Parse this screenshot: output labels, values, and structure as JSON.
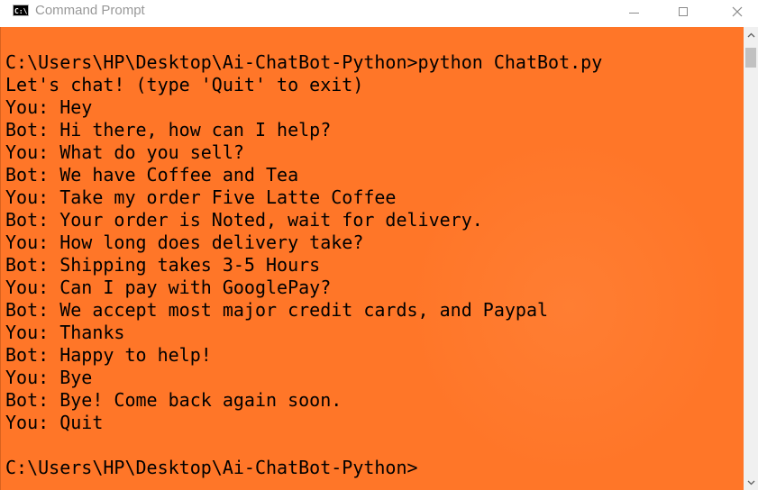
{
  "window": {
    "title": "Command Prompt",
    "icon_label": "C:\\"
  },
  "console": {
    "lines": [
      "C:\\Users\\HP\\Desktop\\Ai-ChatBot-Python>python ChatBot.py",
      "Let's chat! (type 'Quit' to exit)",
      "You: Hey",
      "Bot: Hi there, how can I help?",
      "You: What do you sell?",
      "Bot: We have Coffee and Tea",
      "You: Take my order Five Latte Coffee",
      "Bot: Your order is Noted, wait for delivery.",
      "You: How long does delivery take?",
      "Bot: Shipping takes 3-5 Hours",
      "You: Can I pay with GooglePay?",
      "Bot: We accept most major credit cards, and Paypal",
      "You: Thanks",
      "Bot: Happy to help!",
      "You: Bye",
      "Bot: Bye! Come back again soon.",
      "You: Quit",
      "",
      "C:\\Users\\HP\\Desktop\\Ai-ChatBot-Python>"
    ]
  },
  "colors": {
    "console_background": "#ff7628",
    "console_text": "#000000",
    "titlebar_background": "#ffffff"
  },
  "icons": {
    "app": "cmd-icon",
    "minimize": "minimize-icon",
    "maximize": "maximize-icon",
    "close": "close-icon",
    "scroll_up": "chevron-up-icon",
    "scroll_down": "chevron-down-icon"
  }
}
